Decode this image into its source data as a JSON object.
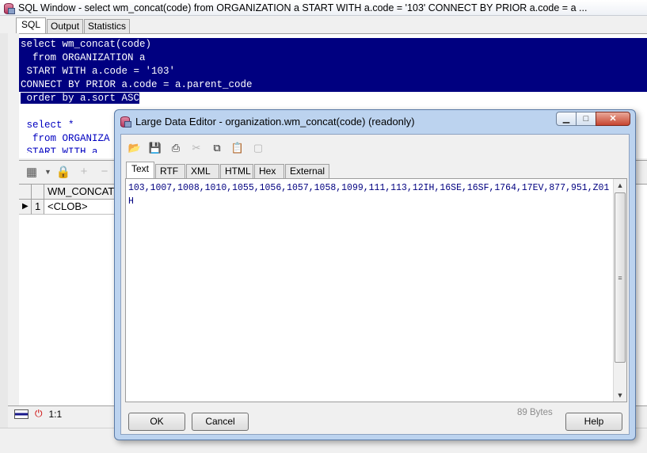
{
  "sql_window": {
    "title": "SQL Window - select wm_concat(code) from ORGANIZATION a START WITH a.code = '103' CONNECT BY PRIOR a.code = a ...",
    "tabs": [
      {
        "label": "SQL",
        "active": true
      },
      {
        "label": "Output",
        "active": false
      },
      {
        "label": "Statistics",
        "active": false
      }
    ],
    "editor_lines": [
      "select wm_concat(code)",
      "  from ORGANIZATION a",
      " START WITH a.code = '103'",
      "CONNECT BY PRIOR a.code = a.parent_code",
      " order by a.sort ASC",
      "",
      " select *",
      "  from ORGANIZA",
      " START WITH a"
    ],
    "grid": {
      "column_header": "WM_CONCAT",
      "row_number": "1",
      "row_value": "<CLOB>"
    },
    "status": {
      "position": "1:1"
    }
  },
  "dialog": {
    "title": "Large Data Editor - organization.wm_concat(code) (readonly)",
    "window_buttons": {
      "minimize": "▁",
      "maximize": "□",
      "close": "✕"
    },
    "toolbar_icons": [
      "open-folder-icon",
      "save-icon",
      "print-icon",
      "cut-icon",
      "copy-icon",
      "paste-icon",
      "clear-icon"
    ],
    "tabs": [
      {
        "label": "Text",
        "active": true
      },
      {
        "label": "RTF",
        "active": false
      },
      {
        "label": "XML",
        "active": false
      },
      {
        "label": "HTML",
        "active": false
      },
      {
        "label": "Hex",
        "active": false
      },
      {
        "label": "External",
        "active": false
      }
    ],
    "content": "103,1007,1008,1010,1055,1056,1057,1058,1099,111,113,12IH,16SE,16SF,1764,17EV,877,951,Z01H",
    "size_label": "89 Bytes",
    "buttons": {
      "ok": "OK",
      "cancel": "Cancel",
      "help": "Help"
    }
  },
  "colors": {
    "selection": "#000080",
    "text_content": "#000080",
    "dialog_frame": "#bcd3ef"
  }
}
